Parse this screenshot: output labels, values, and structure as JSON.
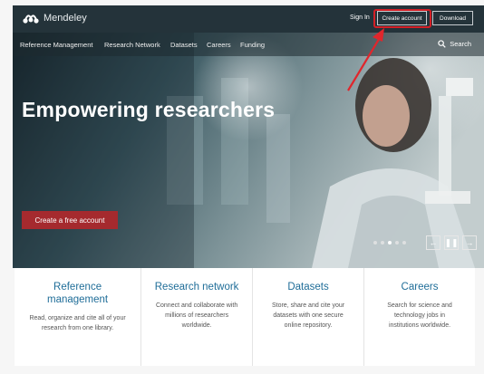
{
  "header": {
    "logo_text": "Mendeley",
    "sign_in": "Sign In",
    "create_account": "Create account",
    "download": "Download"
  },
  "nav": {
    "items": [
      "Reference Management",
      "Research Network",
      "Datasets",
      "Careers",
      "Funding"
    ],
    "search": "Search"
  },
  "hero": {
    "title": "Empowering researchers",
    "cta": "Create a free account",
    "pager_dot_count": 5,
    "pager_active_index": 2
  },
  "cards": [
    {
      "title": "Reference management",
      "desc": "Read, organize and cite all of your research from one library."
    },
    {
      "title": "Research network",
      "desc": "Connect and collaborate with millions of researchers worldwide."
    },
    {
      "title": "Datasets",
      "desc": "Store, share and cite your datasets with one secure online repository."
    },
    {
      "title": "Careers",
      "desc": "Search for science and technology jobs in institutions worldwide."
    }
  ],
  "colors": {
    "topbar": "#24333a",
    "cta": "#a52a2e",
    "highlight": "#d41f26",
    "card_title": "#1f6d98"
  }
}
